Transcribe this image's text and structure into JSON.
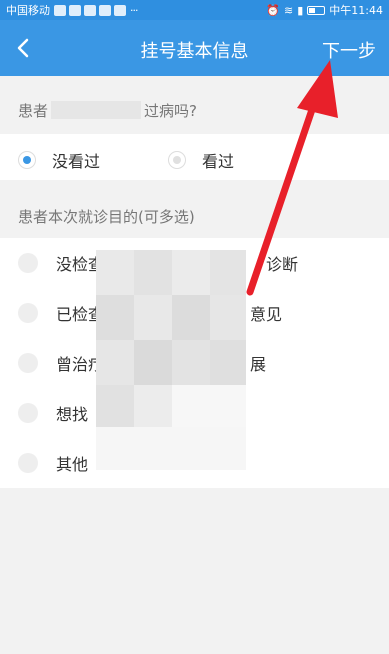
{
  "status_bar": {
    "carrier": "中国移动",
    "time": "中午11:44"
  },
  "nav": {
    "title": "挂号基本信息",
    "next_label": "下一步"
  },
  "visit_question": {
    "prefix": "患者",
    "suffix": "过病吗?",
    "options": [
      {
        "label": "没看过",
        "checked": true
      },
      {
        "label": "看过",
        "checked": false
      }
    ]
  },
  "purpose": {
    "header": "患者本次就诊目的(可多选)",
    "items": [
      {
        "visible_start": "没检查",
        "visible_end": "诊断"
      },
      {
        "visible_start": "已检查",
        "visible_end": "意见"
      },
      {
        "visible_start": "曾治疗",
        "visible_end": "展"
      },
      {
        "visible_start": "想找",
        "visible_end": ""
      },
      {
        "visible_start": "其他",
        "visible_end": ""
      }
    ]
  },
  "colors": {
    "primary": "#3a97e4",
    "status_bar": "#2f8fe0",
    "arrow": "#e8202a"
  }
}
